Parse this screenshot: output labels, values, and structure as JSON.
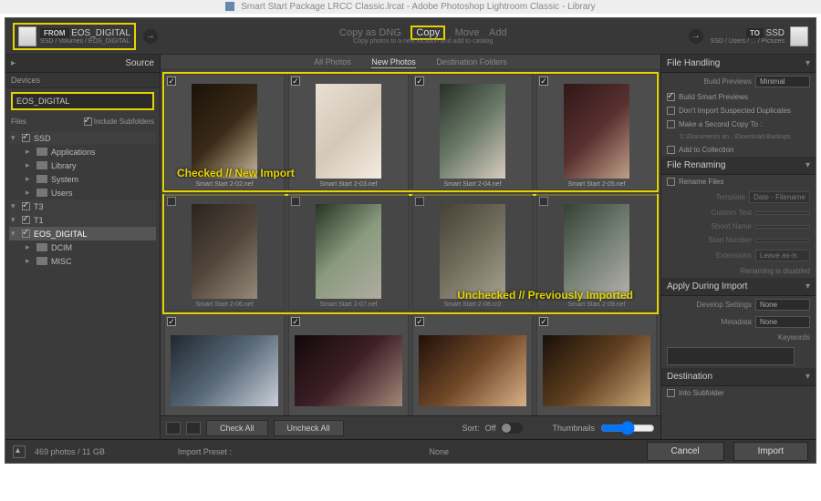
{
  "window_title": "Smart Start Package LRCC Classic.lrcat - Adobe Photoshop Lightroom Classic - Library",
  "from": {
    "badge": "FROM",
    "device": "EOS_DIGITAL",
    "path": "SSD / Volumes / EOS_DIGITAL"
  },
  "to": {
    "badge": "TO",
    "device": "SSD",
    "path": "SSD / Users / ... / Pictures"
  },
  "actions": {
    "dng": "Copy as DNG",
    "copy": "Copy",
    "move": "Move",
    "add": "Add",
    "subtitle": "Copy photos to a new location and add to catalog"
  },
  "source": {
    "title": "Source",
    "devices_label": "Devices",
    "selected_device": "EOS_DIGITAL",
    "files_label": "Files",
    "include_sub_label": "Include Subfolders",
    "volumes": [
      {
        "name": "SSD",
        "children": [
          "Applications",
          "Library",
          "System",
          "Users"
        ]
      },
      {
        "name": "T3",
        "children": []
      },
      {
        "name": "T1",
        "children": []
      },
      {
        "name": "EOS_DIGITAL",
        "children": [
          "DCIM",
          "MISC"
        ],
        "selected": true
      }
    ]
  },
  "tabs": {
    "all": "All Photos",
    "new": "New Photos",
    "dest": "Destination Folders"
  },
  "callouts": {
    "checked": "Checked // New Import",
    "unchecked": "Unchecked // Previously Imported"
  },
  "thumbs": [
    [
      {
        "file": "Smart Start 2-02.nef",
        "checked": true
      },
      {
        "file": "Smart Start 2-03.nef",
        "checked": true
      },
      {
        "file": "Smart Start 2-04.nef",
        "checked": true
      },
      {
        "file": "Smart Start 2-05.nef",
        "checked": true
      }
    ],
    [
      {
        "file": "Smart Start 2-06.nef",
        "checked": false
      },
      {
        "file": "Smart Start 2-07.nef",
        "checked": false
      },
      {
        "file": "Smart Start 2-08.cr2",
        "checked": false
      },
      {
        "file": "Smart Start 2-09.nef",
        "checked": false
      }
    ],
    [
      {
        "file": "",
        "checked": true
      },
      {
        "file": "",
        "checked": true
      },
      {
        "file": "",
        "checked": true
      },
      {
        "file": "",
        "checked": true
      }
    ]
  ],
  "mid_footer": {
    "check_all": "Check All",
    "uncheck_all": "Uncheck All",
    "sort_label": "Sort:",
    "sort_value": "Off",
    "thumb_label": "Thumbnails"
  },
  "right": {
    "file_handling": "File Handling",
    "build_previews_label": "Build Previews",
    "build_previews_value": "Minimal",
    "smart_previews": "Build Smart Previews",
    "suspected": "Don't Import Suspected Duplicates",
    "second_copy": "Make a Second Copy To :",
    "second_copy_path": "C:\\Documents an...\\Download Backups",
    "add_collection": "Add to Collection",
    "file_renaming": "File Renaming",
    "rename_files": "Rename Files",
    "template_label": "Template",
    "template_value": "Date - Filename",
    "custom_text": "Custom Text",
    "shoot_name": "Shoot Name",
    "start_number": "Start Number",
    "extensions_label": "Extensions",
    "extensions_value": "Leave as-is",
    "renaming_disabled": "Renaming is disabled",
    "apply_during": "Apply During Import",
    "develop_label": "Develop Settings",
    "develop_value": "None",
    "metadata_label": "Metadata",
    "metadata_value": "None",
    "keywords": "Keywords",
    "destination": "Destination",
    "into_subfolder": "Into Subfolder"
  },
  "bottom": {
    "status": "469 photos / 11 GB",
    "preset_label": "Import Preset :",
    "preset_value": "None",
    "cancel": "Cancel",
    "import": "Import"
  }
}
